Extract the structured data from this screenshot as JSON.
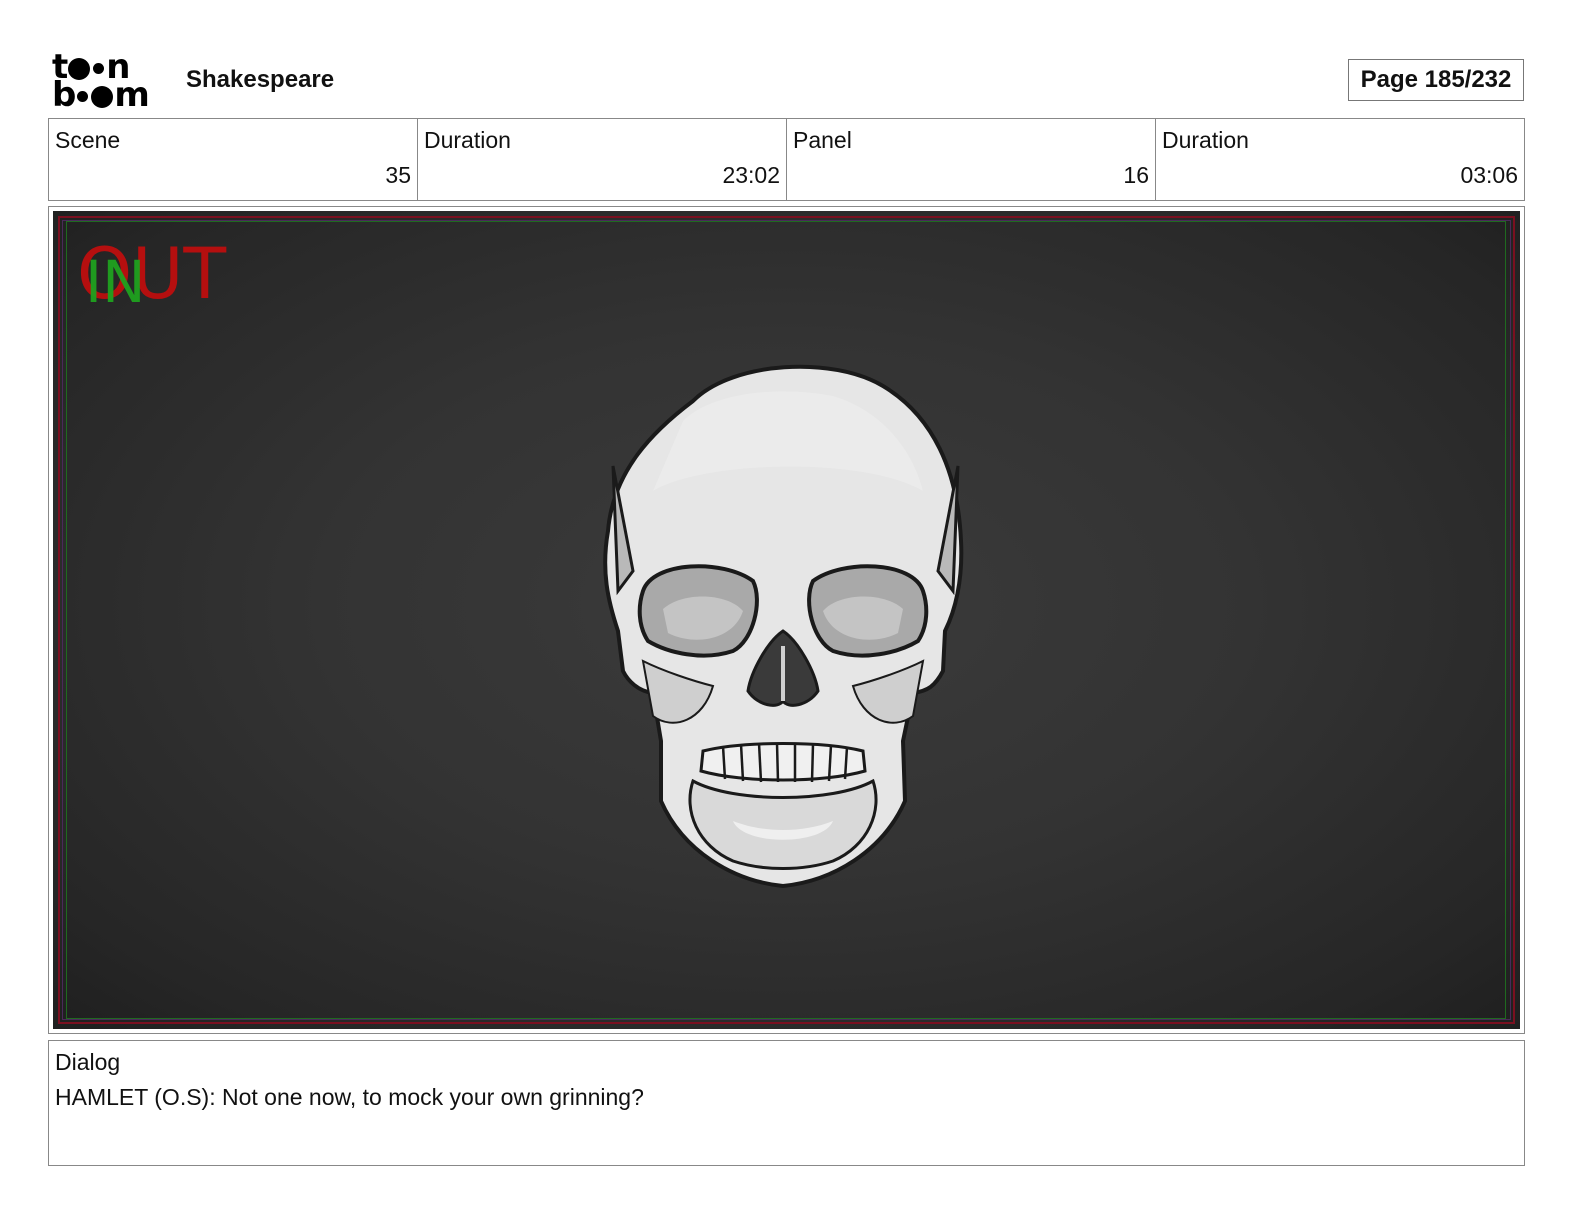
{
  "header": {
    "logo_text": "toon boom",
    "project_title": "Shakespeare",
    "page_label": "Page 185/232"
  },
  "info": {
    "scene_label": "Scene",
    "scene_value": "35",
    "scene_duration_label": "Duration",
    "scene_duration_value": "23:02",
    "panel_label": "Panel",
    "panel_value": "16",
    "panel_duration_label": "Duration",
    "panel_duration_value": "03:06"
  },
  "panel": {
    "out_tag": "OUT",
    "in_tag": "IN"
  },
  "dialog": {
    "label": "Dialog",
    "text": "HAMLET (O.S): Not one now, to mock your own grinning?"
  },
  "colors": {
    "out_tag": "#b50f0f",
    "in_tag": "#1fa21f",
    "safe_frame_red": "#7a1020",
    "safe_frame_green": "#1f6a1f"
  }
}
